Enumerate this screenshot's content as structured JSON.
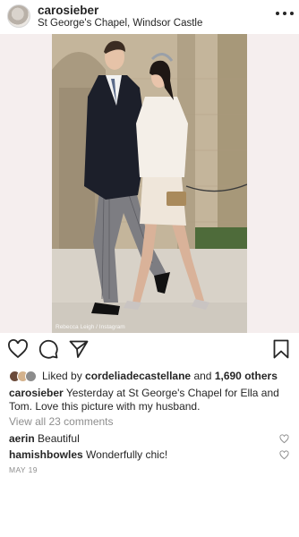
{
  "post": {
    "username": "carosieber",
    "location": "St George's Chapel, Windsor Castle",
    "photo_credit": "Rebecca Leigh / Instagram"
  },
  "icons": [
    "more-options-icon",
    "heart-icon",
    "comment-icon",
    "share-icon",
    "bookmark-icon"
  ],
  "likes": {
    "prefix": "Liked by",
    "user": "cordeliadecastellane",
    "conjunction": "and",
    "others": "1,690 others"
  },
  "caption": {
    "username": "carosieber",
    "text": "Yesterday at St George's Chapel for Ella and Tom. Love this picture with my husband."
  },
  "comments": {
    "view_all": "View all 23 comments",
    "items": [
      {
        "username": "aerin",
        "text": "Beautiful"
      },
      {
        "username": "hamishbowles",
        "text": "Wonderfully chic!"
      }
    ]
  },
  "date": "MAY 19",
  "colors": {
    "text": "#262626",
    "muted": "#8e8e8e",
    "background": "#ffffff"
  }
}
